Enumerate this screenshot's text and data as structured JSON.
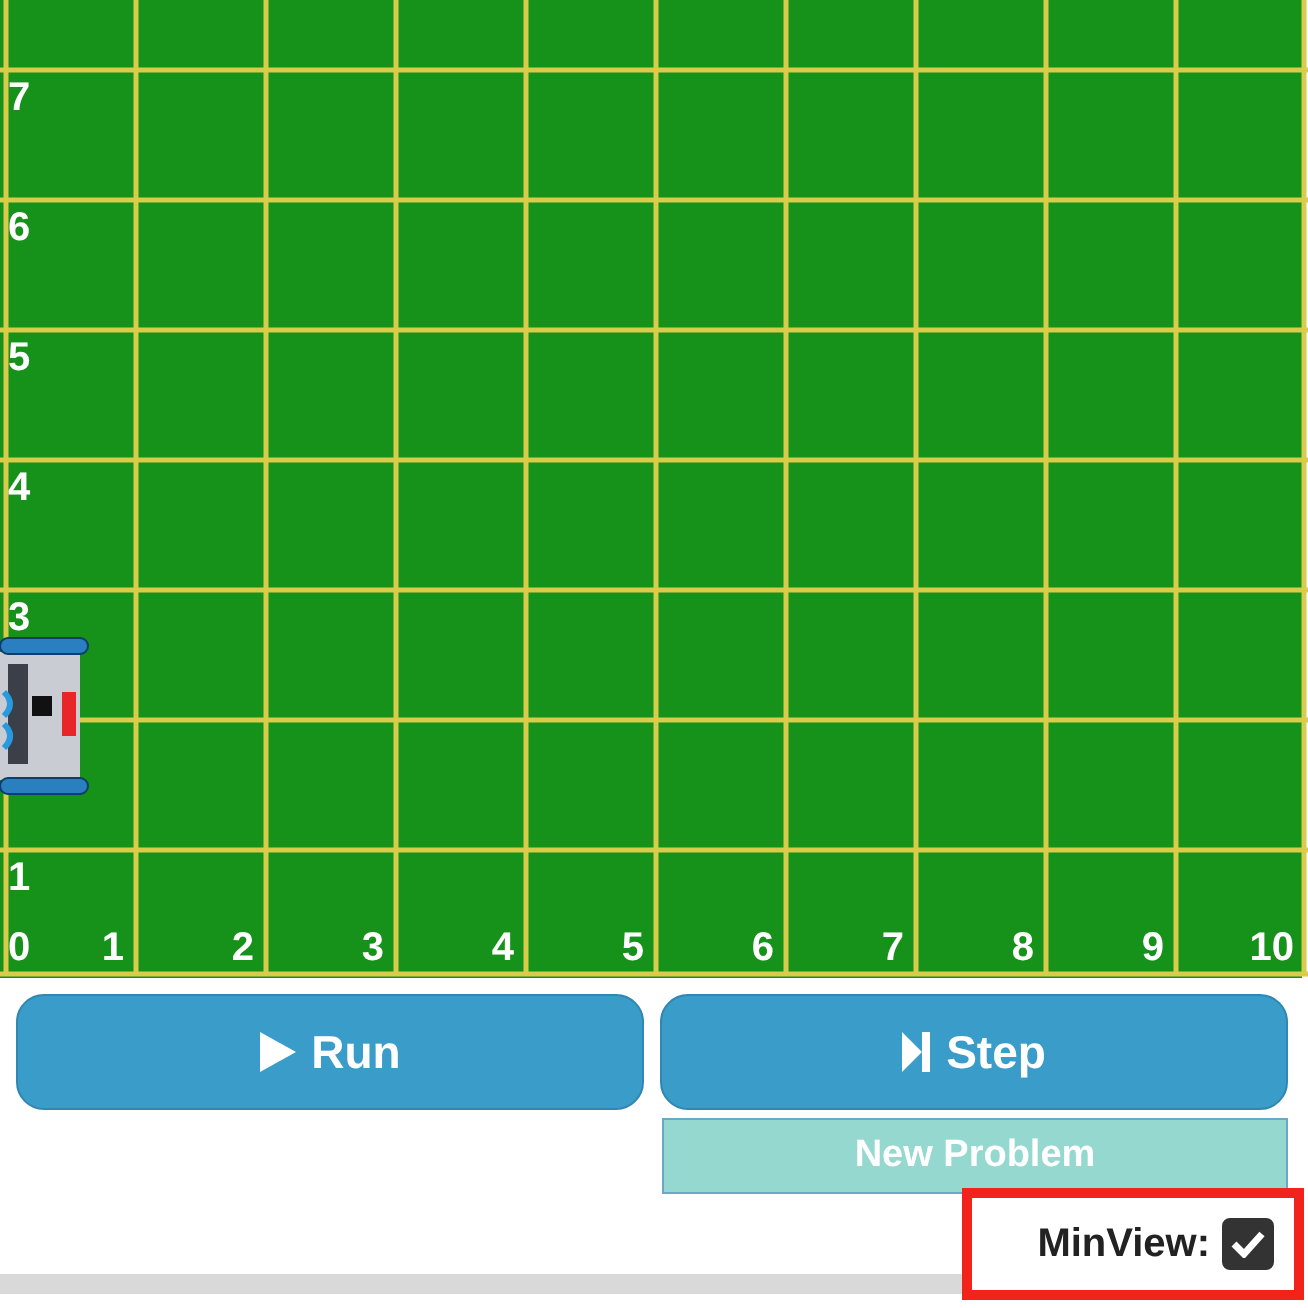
{
  "board": {
    "y_labels": [
      "7",
      "6",
      "5",
      "4",
      "3",
      "1"
    ],
    "x_labels": [
      "0",
      "1",
      "2",
      "3",
      "4",
      "5",
      "6",
      "7",
      "8",
      "9",
      "10"
    ]
  },
  "buttons": [
    {
      "kind": "run",
      "label": "Run"
    },
    {
      "kind": "step",
      "label": "Step"
    }
  ],
  "new_problem": {
    "label": "New Problem"
  },
  "minview": {
    "label": "MinView:",
    "checked": true,
    "highlighted": true
  }
}
